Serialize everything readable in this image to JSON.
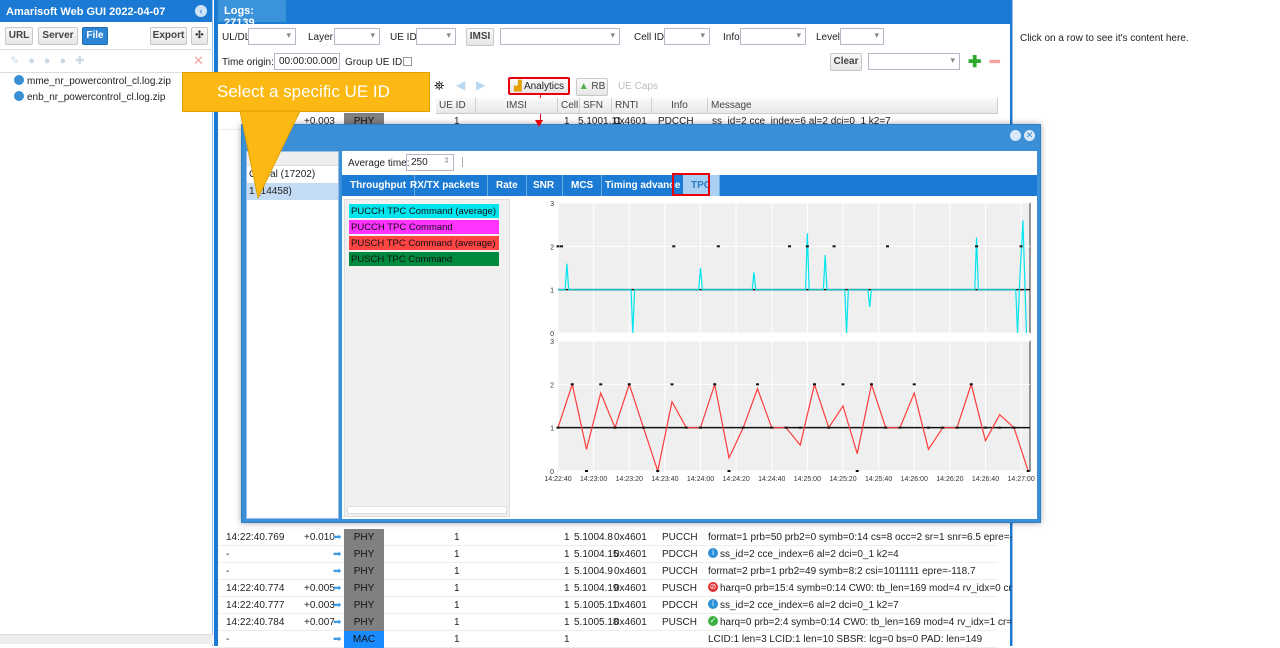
{
  "app": {
    "title": "Amarisoft Web GUI 2022-04-07",
    "buttons": {
      "url": "URL",
      "server": "Server",
      "file": "File",
      "export": "Export"
    },
    "files": [
      {
        "name": "mme_nr_powercontrol_cl.log.zip",
        "icon": "server-icon"
      },
      {
        "name": "enb_nr_powercontrol_cl.log.zip",
        "icon": "antenna-icon"
      }
    ]
  },
  "logs": {
    "tab": "Logs: 27139",
    "filters": {
      "uldl": "UL/DL",
      "layer": "Layer",
      "ueid": "UE ID",
      "imsi": "IMSI",
      "cellid": "Cell ID",
      "info": "Info",
      "level": "Level",
      "time_origin_label": "Time origin:",
      "time_origin": "00:00:00.000",
      "group_ue": "Group UE ID:",
      "clear": "Clear"
    },
    "toolbar": {
      "analytics": "Analytics",
      "rb": "RB",
      "uecaps": "UE Caps"
    },
    "columns": [
      "UE ID",
      "IMSI",
      "Cell",
      "SFN",
      "RNTI",
      "Info",
      "Message"
    ],
    "top_row": {
      "time": "",
      "delta": "+0.003",
      "layer": "PHY",
      "ue": "1",
      "cell": "1",
      "sfn": "5.1001.11",
      "rnti": "0x4601",
      "info": "PDCCH",
      "msg": "ss_id=2 cce_index=6 al=2 dci=0_1 k2=7"
    },
    "rows": [
      {
        "time": "14:22:40.769",
        "delta": "+0.010",
        "layer": "PHY",
        "ue": "1",
        "cell": "1",
        "sfn": "5.1004.8",
        "rnti": "0x4601",
        "info": "PUCCH",
        "msg": "format=1 prb=50 prb2=0 symb=0:14 cs=8 occ=2 sr=1 snr=6.5 epre=-123.1",
        "icon": ""
      },
      {
        "time": "-",
        "delta": "",
        "layer": "PHY",
        "ue": "1",
        "cell": "1",
        "sfn": "5.1004.15",
        "rnti": "0x4601",
        "info": "PDCCH",
        "msg": "ss_id=2 cce_index=6 al=2 dci=0_1 k2=4",
        "icon": "info"
      },
      {
        "time": "-",
        "delta": "",
        "layer": "PHY",
        "ue": "1",
        "cell": "1",
        "sfn": "5.1004.9",
        "rnti": "0x4601",
        "info": "PUCCH",
        "msg": "format=2 prb=1 prb2=49 symb=8:2 csi=1011111 epre=-118.7",
        "icon": ""
      },
      {
        "time": "14:22:40.774",
        "delta": "+0.005",
        "layer": "PHY",
        "ue": "1",
        "cell": "1",
        "sfn": "5.1004.19",
        "rnti": "0x4601",
        "info": "PUSCH",
        "msg": "harq=0 prb=15:4 symb=0:14 CW0: tb_len=169 mod=4 rv_idx=0 cr=0.55 r",
        "icon": "error"
      },
      {
        "time": "14:22:40.777",
        "delta": "+0.003",
        "layer": "PHY",
        "ue": "1",
        "cell": "1",
        "sfn": "5.1005.11",
        "rnti": "0x4601",
        "info": "PDCCH",
        "msg": "ss_id=2 cce_index=6 al=2 dci=0_1 k2=7",
        "icon": "info"
      },
      {
        "time": "14:22:40.784",
        "delta": "+0.007",
        "layer": "PHY",
        "ue": "1",
        "cell": "1",
        "sfn": "5.1005.18",
        "rnti": "0x4601",
        "info": "PUSCH",
        "msg": "harq=0 prb=2:4 symb=0:14 CW0: tb_len=169 mod=4 rv_idx=1 cr=0.55 re",
        "icon": "ok"
      },
      {
        "time": "-",
        "delta": "",
        "layer": "MAC",
        "ue": "1",
        "cell": "1",
        "sfn": "",
        "rnti": "",
        "info": "",
        "msg": "LCID:1 len=3 LCID:1 len=10 SBSR: lcg=0 bs=0 PAD: len=149",
        "icon": ""
      }
    ]
  },
  "right_panel": {
    "hint": "Click on a row to see it's content here."
  },
  "analytics": {
    "title": "Analytics",
    "title_visible": "s",
    "list": [
      "Global (17202)",
      "1 (14458)"
    ],
    "avg_label": "Average time:",
    "avg_value": "250",
    "tabs": [
      "Throughput",
      "RX/TX packets",
      "Rate",
      "SNR",
      "MCS",
      "Timing advance",
      "TPC"
    ],
    "active_tab": "TPC"
  },
  "callout": {
    "text": "Select a specific UE ID"
  },
  "colors": {
    "header": "#1a7ad4",
    "highlight": "#e8000b",
    "callout": "#fdb913"
  },
  "chart_data": [
    {
      "type": "line",
      "ylim": [
        0,
        3
      ],
      "yticks": [
        "0",
        "1",
        "2",
        "3"
      ],
      "xlim": [
        "14:22:40",
        "14:27:05"
      ],
      "grid": true,
      "series": [
        {
          "name": "PUCCH TPC Command (average)",
          "color": "#00e5ee",
          "style": "line",
          "points": [
            [
              "14:22:40",
              1
            ],
            [
              "14:22:44",
              1
            ],
            [
              "14:22:45",
              1.6
            ],
            [
              "14:22:46",
              1
            ],
            [
              "14:23:21",
              1
            ],
            [
              "14:23:22",
              0
            ],
            [
              "14:23:23",
              1
            ],
            [
              "14:23:59",
              1
            ],
            [
              "14:24:00",
              1.5
            ],
            [
              "14:24:01",
              1
            ],
            [
              "14:24:29",
              1
            ],
            [
              "14:24:30",
              1.4
            ],
            [
              "14:24:31",
              1
            ],
            [
              "14:24:59",
              1
            ],
            [
              "14:25:00",
              2.3
            ],
            [
              "14:25:01",
              1
            ],
            [
              "14:25:09",
              1
            ],
            [
              "14:25:10",
              1.8
            ],
            [
              "14:25:11",
              1
            ],
            [
              "14:25:21",
              1
            ],
            [
              "14:25:22",
              0
            ],
            [
              "14:25:23",
              1
            ],
            [
              "14:25:34",
              1
            ],
            [
              "14:25:35",
              0.6
            ],
            [
              "14:25:36",
              1
            ],
            [
              "14:26:34",
              1
            ],
            [
              "14:26:35",
              2.2
            ],
            [
              "14:26:36",
              1
            ],
            [
              "14:26:57",
              1
            ],
            [
              "14:26:58",
              0
            ],
            [
              "14:26:59",
              1
            ],
            [
              "14:27:01",
              2.6
            ],
            [
              "14:27:03",
              0
            ]
          ]
        },
        {
          "name": "PUCCH TPC Command",
          "color": "#111111",
          "style": "points",
          "points": [
            [
              "14:22:40",
              2
            ],
            [
              "14:22:42",
              2
            ],
            [
              "14:23:45",
              2
            ],
            [
              "14:24:10",
              2
            ],
            [
              "14:24:50",
              2
            ],
            [
              "14:25:00",
              2
            ],
            [
              "14:25:15",
              2
            ],
            [
              "14:25:45",
              2
            ],
            [
              "14:26:35",
              2
            ],
            [
              "14:27:00",
              2
            ]
          ]
        }
      ]
    },
    {
      "type": "line",
      "ylim": [
        0,
        3
      ],
      "yticks": [
        "0",
        "1",
        "2",
        "3"
      ],
      "xlim": [
        "14:22:40",
        "14:27:05"
      ],
      "grid": true,
      "xticks": [
        "14:22:40",
        "14:23:00",
        "14:23:20",
        "14:23:40",
        "14:24:00",
        "14:24:20",
        "14:24:40",
        "14:25:00",
        "14:25:20",
        "14:25:40",
        "14:26:00",
        "14:26:20",
        "14:26:40",
        "14:27:00"
      ],
      "series": [
        {
          "name": "PUSCH TPC Command (average)",
          "color": "#ff3b3b",
          "style": "line",
          "points": [
            [
              "14:22:40",
              1
            ],
            [
              "14:22:48",
              2
            ],
            [
              "14:22:56",
              0.5
            ],
            [
              "14:23:04",
              1.8
            ],
            [
              "14:23:12",
              1
            ],
            [
              "14:23:20",
              2
            ],
            [
              "14:23:28",
              1
            ],
            [
              "14:23:36",
              0
            ],
            [
              "14:23:44",
              1.6
            ],
            [
              "14:23:52",
              1
            ],
            [
              "14:24:00",
              1
            ],
            [
              "14:24:08",
              2
            ],
            [
              "14:24:16",
              0.3
            ],
            [
              "14:24:24",
              1
            ],
            [
              "14:24:32",
              1.9
            ],
            [
              "14:24:40",
              1
            ],
            [
              "14:24:48",
              1
            ],
            [
              "14:24:56",
              0.6
            ],
            [
              "14:25:04",
              2
            ],
            [
              "14:25:12",
              1
            ],
            [
              "14:25:20",
              1.5
            ],
            [
              "14:25:28",
              0.4
            ],
            [
              "14:25:36",
              2
            ],
            [
              "14:25:44",
              1
            ],
            [
              "14:25:52",
              1
            ],
            [
              "14:26:00",
              1.8
            ],
            [
              "14:26:08",
              0.5
            ],
            [
              "14:26:16",
              1
            ],
            [
              "14:26:24",
              1
            ],
            [
              "14:26:32",
              2
            ],
            [
              "14:26:40",
              0.7
            ],
            [
              "14:26:48",
              1.3
            ],
            [
              "14:26:56",
              1
            ],
            [
              "14:27:04",
              0
            ]
          ]
        },
        {
          "name": "PUSCH TPC Command",
          "color": "#111111",
          "style": "points",
          "points": [
            [
              "14:22:40",
              1
            ],
            [
              "14:22:48",
              2
            ],
            [
              "14:22:56",
              0
            ],
            [
              "14:23:04",
              2
            ],
            [
              "14:23:12",
              1
            ],
            [
              "14:23:20",
              2
            ],
            [
              "14:23:28",
              1
            ],
            [
              "14:23:36",
              0
            ],
            [
              "14:23:44",
              2
            ],
            [
              "14:23:52",
              1
            ],
            [
              "14:24:00",
              1
            ],
            [
              "14:24:08",
              2
            ],
            [
              "14:24:16",
              0
            ],
            [
              "14:24:24",
              1
            ],
            [
              "14:24:32",
              2
            ],
            [
              "14:24:40",
              1
            ],
            [
              "14:24:48",
              1
            ],
            [
              "14:24:56",
              1
            ],
            [
              "14:25:04",
              2
            ],
            [
              "14:25:12",
              1
            ],
            [
              "14:25:20",
              2
            ],
            [
              "14:25:28",
              0
            ],
            [
              "14:25:36",
              2
            ],
            [
              "14:25:44",
              1
            ],
            [
              "14:25:52",
              1
            ],
            [
              "14:26:00",
              2
            ],
            [
              "14:26:08",
              1
            ],
            [
              "14:26:16",
              1
            ],
            [
              "14:26:24",
              1
            ],
            [
              "14:26:32",
              2
            ],
            [
              "14:26:40",
              1
            ],
            [
              "14:26:48",
              1
            ],
            [
              "14:26:56",
              1
            ],
            [
              "14:27:04",
              0
            ]
          ]
        }
      ]
    }
  ],
  "legend": [
    {
      "name": "PUCCH TPC Command (average)",
      "color": "#00e5ee"
    },
    {
      "name": "PUCCH TPC Command",
      "color": "#ff33ff"
    },
    {
      "name": "PUSCH TPC Command (average)",
      "color": "#ff4444"
    },
    {
      "name": "PUSCH TPC Command",
      "color": "#008a3e"
    }
  ]
}
